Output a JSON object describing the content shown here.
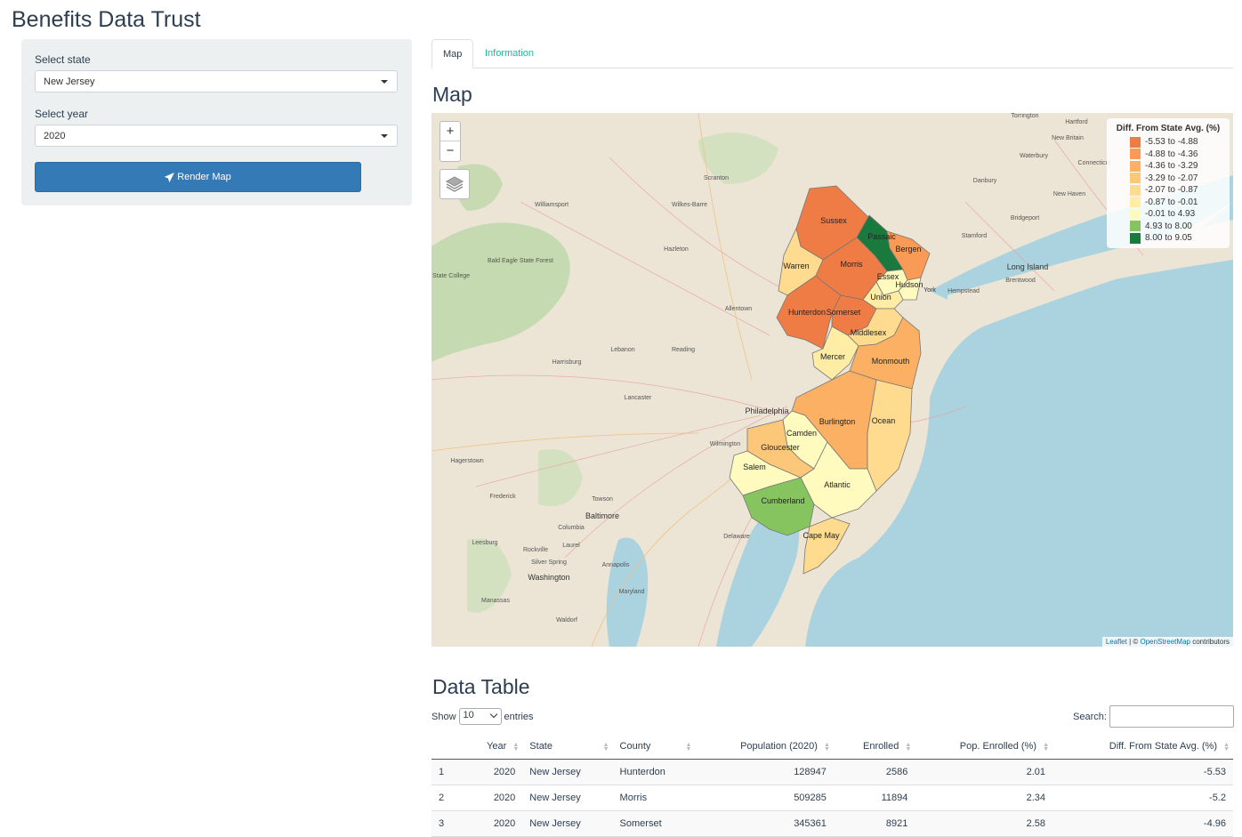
{
  "app": {
    "title": "Benefits Data Trust"
  },
  "sidebar": {
    "state_label": "Select state",
    "state_value": "New Jersey",
    "year_label": "Select year",
    "year_value": "2020",
    "render_button": "Render Map"
  },
  "tabs": [
    {
      "label": "Map",
      "active": true
    },
    {
      "label": "Information",
      "active": false
    }
  ],
  "map_section": {
    "title": "Map"
  },
  "map": {
    "zoom_in": "+",
    "zoom_out": "−",
    "legend_title": "Diff. From State Avg. (%)",
    "legend": [
      {
        "label": "-5.53 to -4.88",
        "color": "#f07c45"
      },
      {
        "label": "-4.88 to -4.36",
        "color": "#f99a57"
      },
      {
        "label": "-4.36 to -3.29",
        "color": "#fbb064"
      },
      {
        "label": "-3.29 to -2.07",
        "color": "#fdc77a"
      },
      {
        "label": "-2.07 to -0.87",
        "color": "#fedb8f"
      },
      {
        "label": "-0.87 to -0.01",
        "color": "#ffeda5"
      },
      {
        "label": "-0.01 to 4.93",
        "color": "#fffabd"
      },
      {
        "label": "4.93 to 8.00",
        "color": "#86c45f"
      },
      {
        "label": "8.00 to 9.05",
        "color": "#1a7a3e"
      }
    ],
    "attribution": {
      "leaflet": "Leaflet",
      "sep": " | © ",
      "osm": "OpenStreetMap",
      "rest": " contributors"
    },
    "counties": [
      {
        "name": "Sussex",
        "bin": 0
      },
      {
        "name": "Passaic",
        "bin": 8
      },
      {
        "name": "Bergen",
        "bin": 1
      },
      {
        "name": "Warren",
        "bin": 4
      },
      {
        "name": "Morris",
        "bin": 0
      },
      {
        "name": "Essex",
        "bin": 6
      },
      {
        "name": "Hudson",
        "bin": 6
      },
      {
        "name": "Union",
        "bin": 5
      },
      {
        "name": "Hunterdon",
        "bin": 0
      },
      {
        "name": "Somerset",
        "bin": 0
      },
      {
        "name": "Middlesex",
        "bin": 4
      },
      {
        "name": "Mercer",
        "bin": 5
      },
      {
        "name": "Monmouth",
        "bin": 2
      },
      {
        "name": "Burlington",
        "bin": 2
      },
      {
        "name": "Ocean",
        "bin": 4
      },
      {
        "name": "Camden",
        "bin": 6
      },
      {
        "name": "Gloucester",
        "bin": 3
      },
      {
        "name": "Salem",
        "bin": 6
      },
      {
        "name": "Atlantic",
        "bin": 6
      },
      {
        "name": "Cumberland",
        "bin": 7
      },
      {
        "name": "Cape May",
        "bin": 4
      }
    ],
    "place_labels": [
      "Scranton",
      "Wilkes-Barre",
      "Williamsport",
      "Hazleton",
      "Allentown",
      "Lebanon",
      "Reading",
      "Harrisburg",
      "Lancaster",
      "York",
      "Philadelphia",
      "Wilmington",
      "Hagerstown",
      "Frederick",
      "Towson",
      "Baltimore",
      "Columbia",
      "Laurel",
      "Rockville",
      "Silver Spring",
      "Annapolis",
      "Washington",
      "Manassas",
      "Waldorf",
      "Leesburg",
      "Maryland",
      "Delaware",
      "Torrington",
      "Hartford",
      "New Britain",
      "Waterbury",
      "Connecticut",
      "Danbury",
      "New Haven",
      "Bridgeport",
      "Stamford",
      "Long Island",
      "Brentwood",
      "Hempstead",
      "York",
      "Bald Eagle State Forest",
      "State College"
    ]
  },
  "table_section": {
    "title": "Data Table"
  },
  "datatable": {
    "show_label": "Show",
    "entries_value": "10",
    "entries_label": "entries",
    "search_label": "Search:",
    "columns": [
      "",
      "Year",
      "State",
      "County",
      "Population (2020)",
      "Enrolled",
      "Pop. Enrolled (%)",
      "Diff. From State Avg. (%)"
    ],
    "rows": [
      [
        "1",
        "2020",
        "New Jersey",
        "Hunterdon",
        "128947",
        "2586",
        "2.01",
        "-5.53"
      ],
      [
        "2",
        "2020",
        "New Jersey",
        "Morris",
        "509285",
        "11894",
        "2.34",
        "-5.2"
      ],
      [
        "3",
        "2020",
        "New Jersey",
        "Somerset",
        "345361",
        "8921",
        "2.58",
        "-4.96"
      ]
    ]
  }
}
